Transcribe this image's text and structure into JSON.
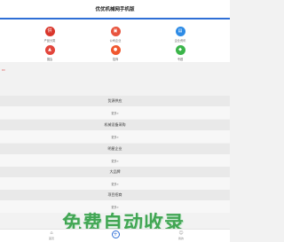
{
  "header": {
    "title": "优优机械网手机版"
  },
  "icons": [
    {
      "label": "产品分类",
      "color": "#d9362b",
      "glyph": "供",
      "icon": "product-category-icon"
    },
    {
      "label": "公司企业",
      "color": "#e8543e",
      "glyph": "▣",
      "icon": "company-icon"
    },
    {
      "label": "企业资讯",
      "color": "#2d8be6",
      "glyph": "▤",
      "icon": "news-icon"
    },
    {
      "label": "展会",
      "color": "#e2453b",
      "glyph": "▲",
      "icon": "expo-icon"
    },
    {
      "label": "招商",
      "color": "#f0572e",
      "glyph": "●",
      "icon": "investment-icon"
    },
    {
      "label": "专题",
      "color": "#3bb54a",
      "glyph": "◆",
      "icon": "topic-icon"
    }
  ],
  "sections": [
    {
      "title": "货源供应",
      "more": "更多»"
    },
    {
      "title": "机械设备采购",
      "more": "更多»"
    },
    {
      "title": "明星企业",
      "more": "更多»"
    },
    {
      "title": "大品牌",
      "more": "更多»"
    },
    {
      "title": "项目招商",
      "more": "更多»"
    }
  ],
  "tabbar": {
    "home": "首页",
    "center": "",
    "mine": "我的"
  },
  "watermark": "免费自动收录"
}
